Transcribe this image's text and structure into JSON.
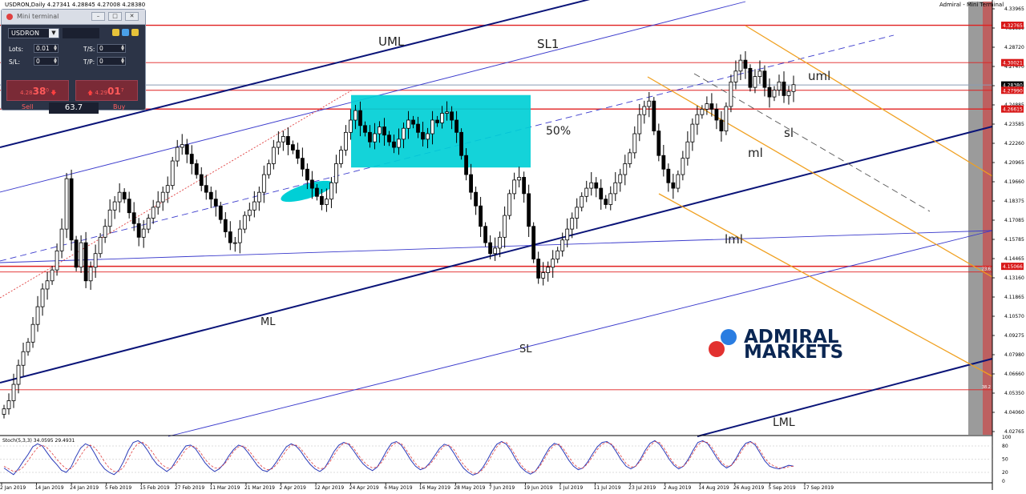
{
  "header": {
    "symbol_info": "USDRON,Daily  4.27341 4.28845 4.27008 4.28380",
    "right_info": "Admiral - Mini Terminal"
  },
  "chart_data": {
    "type": "candlestick",
    "symbol": "USDRON",
    "timeframe": "Daily",
    "ohlc_info": {
      "open": 4.27341,
      "high": 4.28845,
      "low": 4.27008,
      "close": 4.2838
    },
    "x_tick_labels": [
      "2 Jan 2019",
      "14 Jan 2019",
      "24 Jan 2019",
      "5 Feb 2019",
      "15 Feb 2019",
      "27 Feb 2019",
      "11 Mar 2019",
      "21 Mar 2019",
      "2 Apr 2019",
      "12 Apr 2019",
      "24 Apr 2019",
      "6 May 2019",
      "16 May 2019",
      "28 May 2019",
      "7 Jun 2019",
      "19 Jun 2019",
      "1 Jul 2019",
      "11 Jul 2019",
      "23 Jul 2019",
      "2 Aug 2019",
      "14 Aug 2019",
      "26 Aug 2019",
      "5 Sep 2019",
      "17 Sep 2019"
    ],
    "y_tick_labels": [
      "4.33965",
      "4.31330",
      "4.28720",
      "4.27470",
      "4.26105",
      "4.24885",
      "4.23585",
      "4.22260",
      "4.20965",
      "4.19660",
      "4.18375",
      "4.17085",
      "4.15785",
      "4.14465",
      "4.13160",
      "4.11865",
      "4.10570",
      "4.09275",
      "4.07980",
      "4.06660",
      "4.05350",
      "4.04060",
      "4.02765"
    ],
    "ylim": [
      4.027,
      4.345
    ],
    "price_markers": [
      {
        "value": 4.32765,
        "label": "4.32765",
        "color": "#d81818"
      },
      {
        "value": 4.30021,
        "label": "4.30021",
        "color": "#d81818"
      },
      {
        "value": 4.2838,
        "label": "4.28380",
        "color": "#000000"
      },
      {
        "value": 4.2799,
        "label": "4.27990",
        "color": "#d81818"
      },
      {
        "value": 4.26615,
        "label": "4.26615",
        "color": "#d81818"
      },
      {
        "value": 4.15066,
        "label": "4.15066",
        "color": "#d81818"
      }
    ],
    "horizontal_levels": [
      4.32765,
      4.30021,
      4.2838,
      4.2799,
      4.26615,
      4.15066,
      4.1465,
      4.06
    ],
    "fib_labels": [
      {
        "text": "50%",
        "value": 4.25
      },
      {
        "text": "23.6",
        "value": 4.1465
      },
      {
        "text": "38.2",
        "value": 4.06
      }
    ],
    "annotations": [
      "UML",
      "SL1",
      "ML",
      "SL",
      "LML",
      "uml",
      "ml",
      "lml",
      "sl",
      "50%"
    ],
    "candles_close": [
      4.046,
      4.052,
      4.064,
      4.078,
      4.088,
      4.095,
      4.108,
      4.121,
      4.134,
      4.14,
      4.148,
      4.162,
      4.178,
      4.215,
      4.17,
      4.15,
      4.168,
      4.14,
      4.15,
      4.16,
      4.172,
      4.18,
      4.192,
      4.198,
      4.205,
      4.2,
      4.19,
      4.182,
      4.172,
      4.178,
      4.186,
      4.194,
      4.198,
      4.205,
      4.21,
      4.228,
      4.238,
      4.24,
      4.233,
      4.226,
      4.218,
      4.21,
      4.205,
      4.2,
      4.195,
      4.185,
      4.176,
      4.168,
      4.168,
      4.178,
      4.188,
      4.192,
      4.198,
      4.205,
      4.218,
      4.226,
      4.238,
      4.242,
      4.246,
      4.24,
      4.236,
      4.23,
      4.222,
      4.214,
      4.208,
      4.202,
      4.196,
      4.2,
      4.212,
      4.226,
      4.236,
      4.249,
      4.258,
      4.265,
      4.254,
      4.249,
      4.242,
      4.248,
      4.253,
      4.247,
      4.242,
      4.238,
      4.244,
      4.252,
      4.258,
      4.255,
      4.249,
      4.244,
      4.248,
      4.258,
      4.256,
      4.263,
      4.264,
      4.258,
      4.249,
      4.232,
      4.218,
      4.205,
      4.195,
      4.18,
      4.168,
      4.16,
      4.164,
      4.172,
      4.188,
      4.204,
      4.214,
      4.216,
      4.204,
      4.18,
      4.156,
      4.142,
      4.146,
      4.15,
      4.156,
      4.162,
      4.17,
      4.178,
      4.186,
      4.194,
      4.202,
      4.208,
      4.212,
      4.208,
      4.2,
      4.196,
      4.204,
      4.212,
      4.218,
      4.226,
      4.234,
      4.248,
      4.262,
      4.268,
      4.272,
      4.25,
      4.232,
      4.222,
      4.212,
      4.208,
      4.218,
      4.23,
      4.242,
      4.255,
      4.262,
      4.266,
      4.27,
      4.266,
      4.258,
      4.25,
      4.268,
      4.286,
      4.294,
      4.302,
      4.296,
      4.282,
      4.29,
      4.294,
      4.282,
      4.275,
      4.28,
      4.286,
      4.276,
      4.279,
      4.284
    ]
  },
  "indicator": {
    "label": "Stoch(5,3,3) 34.0595 29.4931",
    "ticks": [
      "100",
      "80",
      "50",
      "20",
      "0"
    ],
    "k_values": [
      30,
      22,
      15,
      28,
      45,
      60,
      78,
      85,
      80,
      65,
      50,
      38,
      25,
      20,
      32,
      55,
      75,
      85,
      80,
      62,
      42,
      28,
      20,
      15,
      25,
      45,
      70,
      88,
      92,
      85,
      70,
      52,
      38,
      30,
      22,
      30,
      48,
      65,
      80,
      82,
      74,
      58,
      42,
      30,
      22,
      28,
      40,
      58,
      72,
      82,
      78,
      65,
      50,
      35,
      25,
      22,
      30,
      45,
      62,
      78,
      85,
      80,
      68,
      52,
      38,
      28,
      22,
      30,
      48,
      68,
      82,
      88,
      84,
      70,
      54,
      40,
      30,
      24,
      32,
      50,
      70,
      86,
      90,
      82,
      66,
      48,
      34,
      26,
      30,
      42,
      58,
      74,
      84,
      80,
      64,
      46,
      30,
      20,
      14,
      18,
      30,
      48,
      68,
      84,
      90,
      84,
      68,
      48,
      32,
      22,
      16,
      22,
      38,
      58,
      76,
      86,
      82,
      66,
      48,
      34,
      26,
      30,
      44,
      62,
      78,
      88,
      90,
      82,
      66,
      48,
      34,
      28,
      34,
      50,
      70,
      86,
      92,
      84,
      68,
      50,
      36,
      28,
      34,
      50,
      70,
      88,
      92,
      86,
      70,
      52,
      38,
      30,
      36,
      52,
      72,
      86,
      90,
      82,
      64,
      46,
      34,
      30,
      28,
      32,
      36,
      34
    ],
    "d_values": [
      34,
      28,
      22,
      24,
      32,
      46,
      62,
      76,
      82,
      76,
      64,
      50,
      38,
      28,
      28,
      40,
      58,
      74,
      82,
      76,
      62,
      44,
      30,
      22,
      22,
      32,
      52,
      72,
      86,
      88,
      80,
      66,
      50,
      38,
      30,
      30,
      40,
      56,
      72,
      80,
      78,
      66,
      50,
      38,
      30,
      30,
      38,
      52,
      68,
      78,
      80,
      72,
      58,
      44,
      32,
      26,
      28,
      38,
      54,
      70,
      82,
      82,
      74,
      60,
      46,
      34,
      28,
      30,
      42,
      60,
      76,
      86,
      86,
      76,
      60,
      46,
      36,
      30,
      32,
      44,
      62,
      80,
      88,
      86,
      72,
      56,
      40,
      30,
      30,
      38,
      52,
      68,
      80,
      82,
      72,
      54,
      38,
      26,
      18,
      18,
      26,
      40,
      60,
      78,
      88,
      88,
      74,
      56,
      38,
      26,
      20,
      22,
      34,
      52,
      70,
      82,
      84,
      72,
      56,
      40,
      30,
      30,
      40,
      56,
      72,
      84,
      88,
      84,
      72,
      56,
      40,
      32,
      34,
      46,
      64,
      80,
      90,
      88,
      74,
      56,
      40,
      32,
      34,
      46,
      64,
      82,
      90,
      88,
      76,
      58,
      42,
      34,
      36,
      48,
      66,
      82,
      88,
      86,
      70,
      52,
      40,
      34,
      30,
      30,
      33,
      34
    ]
  },
  "mini_terminal": {
    "title": "Mini terminal",
    "symbol": "USDRON",
    "lots_label": "Lots:",
    "lots_value": "0.01",
    "sl_label": "S/L:",
    "sl_value": "0",
    "ts_label": "T/S:",
    "ts_value": "0",
    "tp_label": "T/P:",
    "tp_value": "0",
    "sell_price_small": "4.28",
    "sell_price_big": "38",
    "sell_price_sup": "0",
    "buy_price_small": "4.29",
    "buy_price_big": "01",
    "buy_price_sup": "7",
    "sell_label": "Sell",
    "buy_label": "Buy",
    "spread": "63.7"
  },
  "brand": {
    "line1": "ADMIRAL",
    "line2": "MARKETS",
    "blue": "#2a7de1",
    "red": "#e2312f",
    "text": "#0b2753"
  },
  "colors": {
    "accent_navy": "#0a1478",
    "channel_blue": "#3a3acc",
    "orange": "#f0a020",
    "level_red": "#e02020",
    "zone_cyan": "#00cfd6",
    "bull": "#ffffff",
    "bear": "#000000"
  }
}
